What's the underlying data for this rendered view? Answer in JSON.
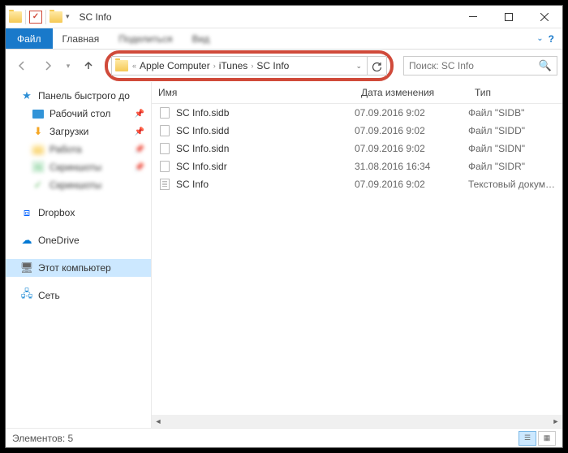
{
  "title": "SC Info",
  "menu": {
    "file": "Файл",
    "home": "Главная"
  },
  "breadcrumb": [
    "Apple Computer",
    "iTunes",
    "SC Info"
  ],
  "search": {
    "placeholder": "Поиск: SC Info"
  },
  "sidebar": {
    "quick": "Панель быстрого до",
    "desktop": "Рабочий стол",
    "downloads": "Загрузки",
    "dropbox": "Dropbox",
    "onedrive": "OneDrive",
    "thispc": "Этот компьютер",
    "network": "Сеть"
  },
  "columns": {
    "name": "Имя",
    "date": "Дата изменения",
    "type": "Тип"
  },
  "files": [
    {
      "name": "SC Info.sidb",
      "date": "07.09.2016 9:02",
      "type": "Файл \"SIDB\"",
      "icon": "generic"
    },
    {
      "name": "SC Info.sidd",
      "date": "07.09.2016 9:02",
      "type": "Файл \"SIDD\"",
      "icon": "generic"
    },
    {
      "name": "SC Info.sidn",
      "date": "07.09.2016 9:02",
      "type": "Файл \"SIDN\"",
      "icon": "generic"
    },
    {
      "name": "SC Info.sidr",
      "date": "31.08.2016 16:34",
      "type": "Файл \"SIDR\"",
      "icon": "generic"
    },
    {
      "name": "SC Info",
      "date": "07.09.2016 9:02",
      "type": "Текстовый докум…",
      "icon": "text"
    }
  ],
  "status": {
    "count_label": "Элементов: 5"
  }
}
